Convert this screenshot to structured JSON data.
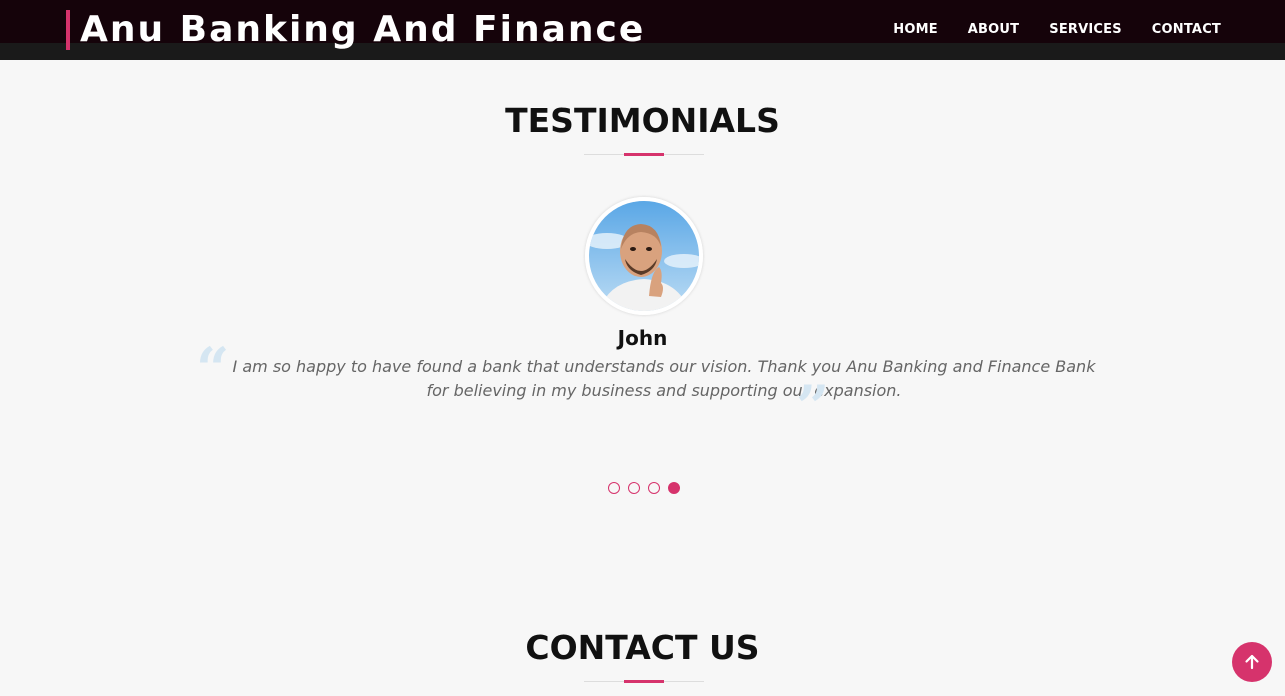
{
  "header": {
    "brand": "Anu Banking And Finance",
    "nav": [
      "HOME",
      "ABOUT",
      "SERVICES",
      "CONTACT"
    ]
  },
  "testimonials": {
    "title": "TESTIMONIALS",
    "name": "John",
    "quote": "I am so happy to have found a bank that understands our vision. Thank you Anu Banking and Finance Bank for believing in my business and supporting our expansion.",
    "open_quote_glyph": "“",
    "close_quote_glyph": "”",
    "slide_count": 4,
    "active_slide": 4
  },
  "contact": {
    "title": "CONTACT US"
  },
  "icons": {
    "back_to_top": "arrow-up-icon"
  },
  "colors": {
    "accent": "#d6336c",
    "header_bg": "#15030a",
    "page_bg": "#f7f7f7"
  }
}
